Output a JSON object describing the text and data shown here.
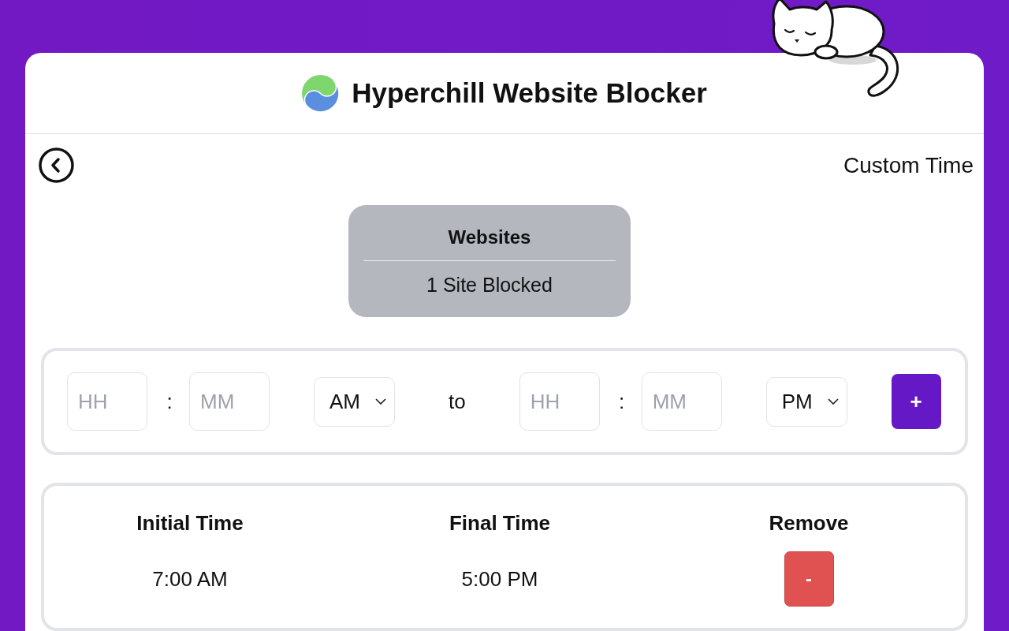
{
  "app": {
    "title": "Hyperchill Website Blocker"
  },
  "nav": {
    "page_title": "Custom Time"
  },
  "websites_card": {
    "heading": "Websites",
    "summary": "1 Site Blocked"
  },
  "time_entry": {
    "start": {
      "hour": {
        "placeholder": "HH"
      },
      "separator": ":",
      "minute": {
        "placeholder": "MM"
      },
      "period": "AM"
    },
    "connector": "to",
    "end": {
      "hour": {
        "placeholder": "HH"
      },
      "separator": ":",
      "minute": {
        "placeholder": "MM"
      },
      "period": "PM"
    },
    "add_button": "+"
  },
  "schedule_table": {
    "columns": [
      "Initial Time",
      "Final Time",
      "Remove"
    ],
    "rows": [
      {
        "initial_time": "7:00 AM",
        "final_time": "5:00 PM",
        "remove_button": "-"
      }
    ]
  }
}
